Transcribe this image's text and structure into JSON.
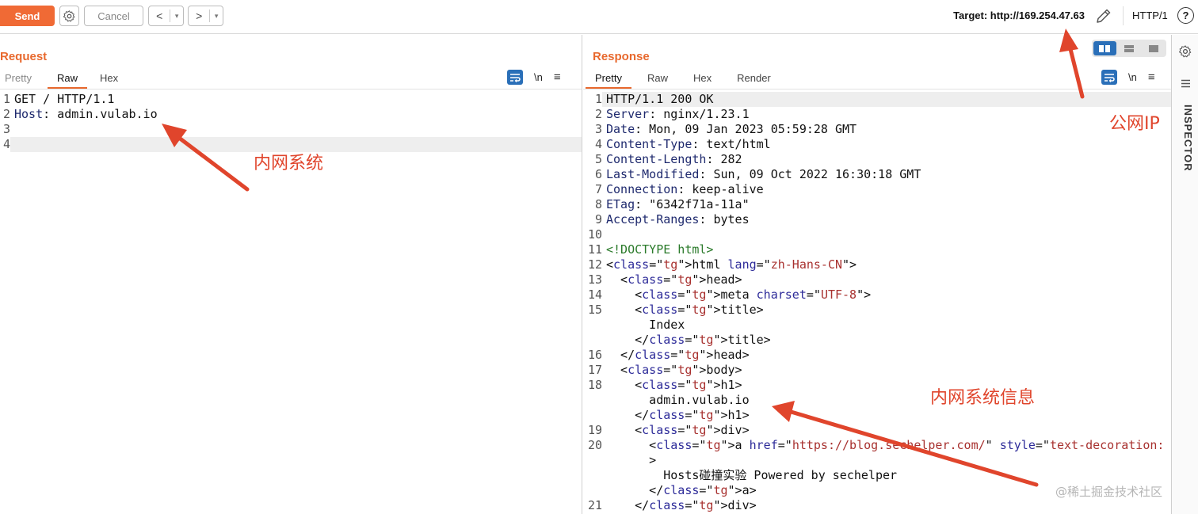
{
  "toolbar": {
    "send_label": "Send",
    "cancel_label": "Cancel",
    "back_label": "<",
    "forward_label": ">",
    "dropdown_glyph": "▾",
    "target_label": "Target: http://169.254.47.63",
    "http_version": "HTTP/1",
    "help_glyph": "?",
    "icons": [
      "gear-icon",
      "edit-icon",
      "help-icon"
    ]
  },
  "request": {
    "title": "Request",
    "tabs": [
      "Pretty",
      "Raw",
      "Hex"
    ],
    "active_tab": "Raw",
    "newline_label": "\\n",
    "menu_glyph": "≡",
    "lines": [
      {
        "n": "1",
        "text": "GET / HTTP/1.1"
      },
      {
        "n": "2",
        "text": "Host: admin.vulab.io"
      },
      {
        "n": "3",
        "text": ""
      },
      {
        "n": "4",
        "text": ""
      }
    ]
  },
  "response": {
    "title": "Response",
    "tabs": [
      "Pretty",
      "Raw",
      "Hex",
      "Render"
    ],
    "active_tab": "Pretty",
    "newline_label": "\\n",
    "menu_glyph": "≡",
    "lines": [
      {
        "n": "1",
        "text": "HTTP/1.1 200 OK"
      },
      {
        "n": "2",
        "text": "Server: nginx/1.23.1"
      },
      {
        "n": "3",
        "text": "Date: Mon, 09 Jan 2023 05:59:28 GMT"
      },
      {
        "n": "4",
        "text": "Content-Type: text/html"
      },
      {
        "n": "5",
        "text": "Content-Length: 282"
      },
      {
        "n": "6",
        "text": "Last-Modified: Sun, 09 Oct 2022 16:30:18 GMT"
      },
      {
        "n": "7",
        "text": "Connection: keep-alive"
      },
      {
        "n": "8",
        "text": "ETag: \"6342f71a-11a\""
      },
      {
        "n": "9",
        "text": "Accept-Ranges: bytes"
      },
      {
        "n": "10",
        "text": ""
      },
      {
        "n": "11",
        "text": "<!DOCTYPE html>"
      },
      {
        "n": "12",
        "text": "<html lang=\"zh-Hans-CN\">"
      },
      {
        "n": "13",
        "text": "  <head>"
      },
      {
        "n": "14",
        "text": "    <meta charset=\"UTF-8\">"
      },
      {
        "n": "15",
        "text": "    <title>"
      },
      {
        "n": "",
        "text": "      Index"
      },
      {
        "n": "",
        "text": "    </title>"
      },
      {
        "n": "16",
        "text": "  </head>"
      },
      {
        "n": "17",
        "text": "  <body>"
      },
      {
        "n": "18",
        "text": "    <h1>"
      },
      {
        "n": "",
        "text": "      admin.vulab.io"
      },
      {
        "n": "",
        "text": "    </h1>"
      },
      {
        "n": "19",
        "text": "    <div>"
      },
      {
        "n": "20",
        "text": "      <a href=\"https://blog.sechelper.com/\" style=\"text-decoration: none\""
      },
      {
        "n": "",
        "text": "      >"
      },
      {
        "n": "",
        "text": "        Hosts碰撞实验 Powered by sechelper"
      },
      {
        "n": "",
        "text": "      </a>"
      },
      {
        "n": "21",
        "text": "    </div>"
      }
    ]
  },
  "inspector_label": "INSPECTOR",
  "annotations": {
    "intranet_system": "内网系统",
    "public_ip": "公网IP",
    "intranet_info": "内网系统信息"
  },
  "watermark": "@稀土掘金技术社区",
  "colors": {
    "accent": "#e8692e",
    "send_button": "#f06a35",
    "annotation": "#e0452c",
    "wrap_active": "#2a6fb8"
  }
}
